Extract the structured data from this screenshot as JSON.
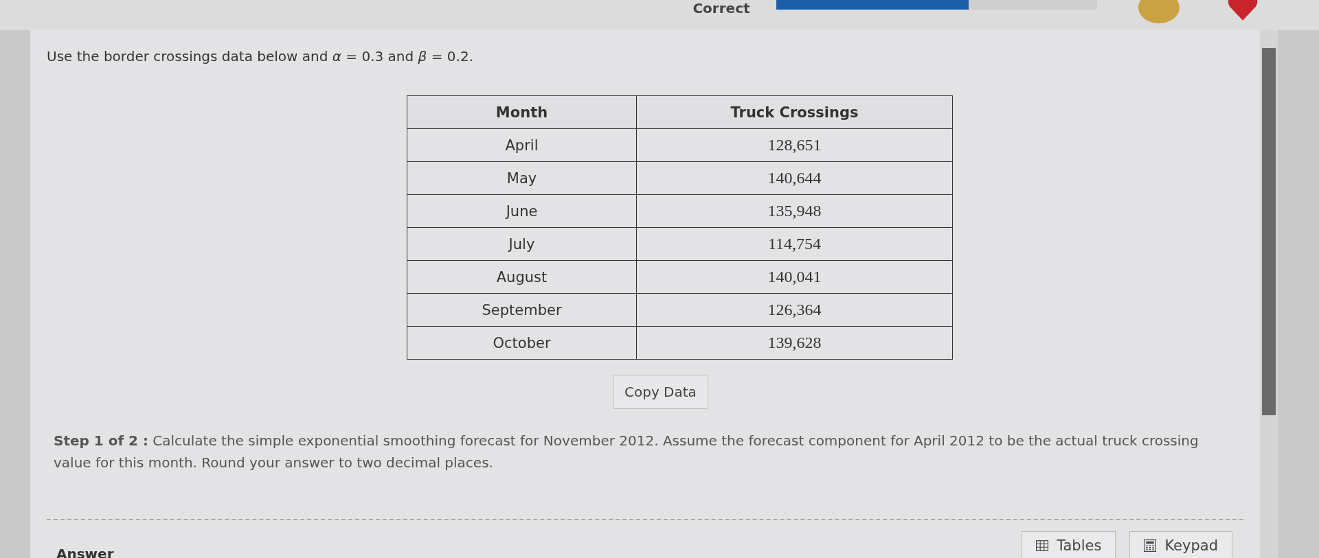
{
  "top_bar": {
    "status": "Correct",
    "progress": {
      "level": 0.6
    }
  },
  "question": {
    "intro": "Use the border crossings data below and *α* = 0.3 and *β* = 0.2.",
    "table": {
      "columns": [
        "Month",
        "Truck Crossings"
      ],
      "rows": [
        [
          "April",
          "128,651"
        ],
        [
          "May",
          "140,644"
        ],
        [
          "June",
          "135,948"
        ],
        [
          "July",
          "114,754"
        ],
        [
          "August",
          "140,041"
        ],
        [
          "September",
          "126,364"
        ],
        [
          "October",
          "139,628"
        ]
      ]
    },
    "copy_button": "Copy Data",
    "step": "**Step 1 of 2 :** Calculate the simple exponential smoothing forecast for November 2012. Assume the forecast component for April 2012 to be the actual truck crossing value for this month. Round your answer to two decimal places."
  },
  "answer": {
    "label": "Answer",
    "buttons": [
      {
        "kind": "tables",
        "label": "Tables"
      },
      {
        "kind": "keypad",
        "label": "Keypad"
      }
    ]
  }
}
